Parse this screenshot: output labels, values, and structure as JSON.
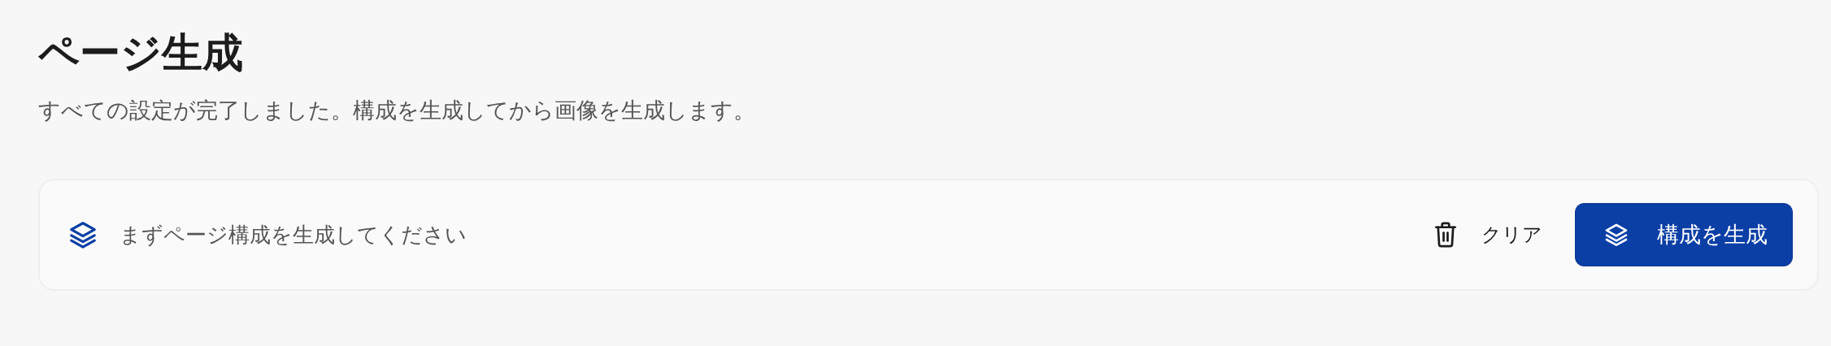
{
  "page": {
    "title": "ページ生成",
    "subtitle": "すべての設定が完了しました。構成を生成してから画像を生成します。"
  },
  "panel": {
    "message": "まずページ構成を生成してください",
    "clear_button": "クリア",
    "generate_button": "構成を生成"
  }
}
